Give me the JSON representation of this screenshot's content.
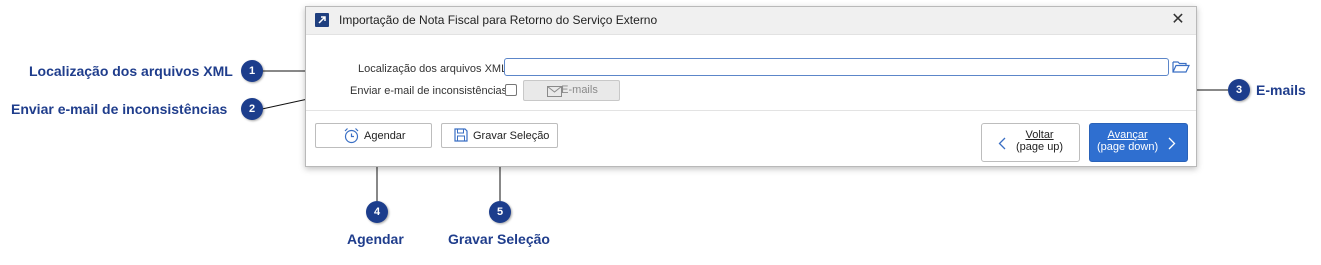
{
  "dialog": {
    "title": "Importação de Nota Fiscal para Retorno do Serviço Externo",
    "close_symbol": "✕",
    "xml_label": "Localização dos arquivos XML",
    "xml_value": "",
    "email_label": "Enviar e-mail de inconsistências",
    "email_checked": false,
    "emails_button": "E-mails",
    "agendar_button": "Agendar",
    "gravar_button": "Gravar Seleção",
    "voltar_line1": "Voltar",
    "voltar_line2": "(page up)",
    "avancar_line1": "Avançar",
    "avancar_line2": "(page down)"
  },
  "annotations": [
    {
      "number": "1",
      "label": "Localização dos arquivos XML"
    },
    {
      "number": "2",
      "label": "Enviar e-mail de inconsistências"
    },
    {
      "number": "3",
      "label": "E-mails"
    },
    {
      "number": "4",
      "label": "Agendar"
    },
    {
      "number": "5",
      "label": "Gravar Seleção"
    }
  ],
  "colors": {
    "annotation": "#1c3d8c",
    "primary_button": "#2f6fd0",
    "input_border": "#5c86c9"
  },
  "icons": [
    "app-icon",
    "close-icon",
    "folder-open-icon",
    "envelope-icon",
    "alarm-clock-icon",
    "save-icon",
    "chevron-left-icon",
    "chevron-right-icon"
  ]
}
